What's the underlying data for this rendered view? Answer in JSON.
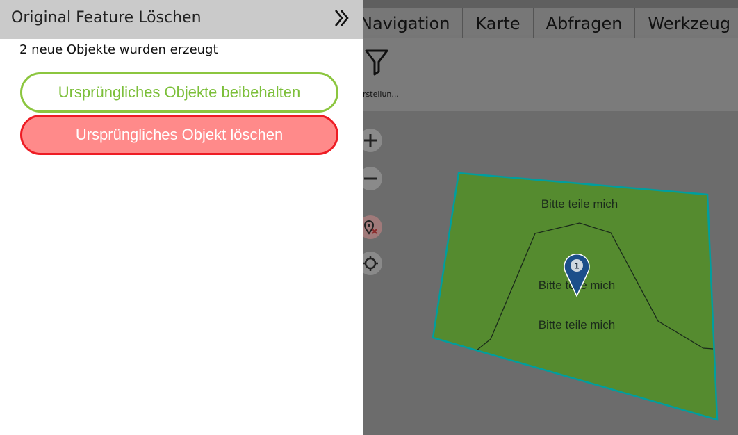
{
  "panel": {
    "title": "Original Feature Löschen",
    "message": "2 neue Objekte wurden erzeugt",
    "keep_label": "Ursprüngliches Objekte beibehalten",
    "delete_label": "Ursprüngliches Objekt löschen",
    "collapse_icon": "double-chevron-right-icon"
  },
  "menu": {
    "tabs": [
      "Navigation",
      "Karte",
      "Abfragen",
      "Werkzeug"
    ]
  },
  "toolbar": {
    "filter_label": "rstellun...",
    "filter_icon": "filter-icon"
  },
  "map": {
    "feature_labels": [
      "Bitte teile mich",
      "Bitte teile mich",
      "Bitte teile mich"
    ],
    "marker_number": "1",
    "controls": [
      "zoom-in-icon",
      "zoom-out-icon",
      "location-remove-icon",
      "gps-icon"
    ]
  },
  "colors": {
    "polygon_fill": "#558b2f",
    "polygon_stroke": "#00a0a0",
    "keep_border": "#8cc63f",
    "delete_border": "#ee1c24",
    "delete_fill": "#ff8a8a"
  }
}
